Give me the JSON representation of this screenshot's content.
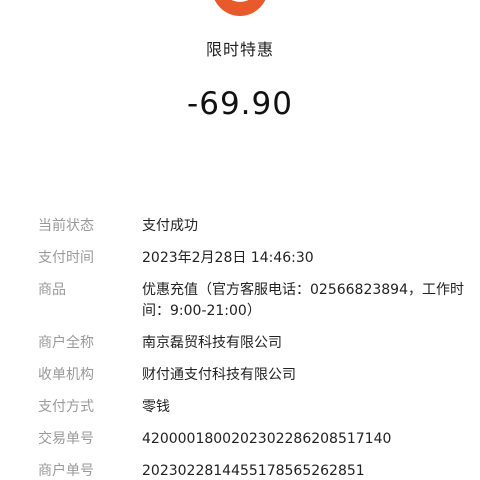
{
  "header": {
    "title": "限时特惠",
    "amount": "-69.90"
  },
  "details": [
    {
      "label": "当前状态",
      "value": "支付成功"
    },
    {
      "label": "支付时间",
      "value": "2023年2月28日 14:46:30"
    },
    {
      "label": "商品",
      "value": "优惠充值（官方客服电话：02566823894，工作时间：9:00-21:00）"
    },
    {
      "label": "商户全称",
      "value": "南京磊贸科技有限公司"
    },
    {
      "label": "收单机构",
      "value": "财付通支付科技有限公司"
    },
    {
      "label": "支付方式",
      "value": "零钱"
    },
    {
      "label": "交易单号",
      "value": "4200001800202302286208517140"
    },
    {
      "label": "商户单号",
      "value": "2023022814455178565262851"
    }
  ],
  "colors": {
    "logo": "#e85a2b",
    "label": "#9a9a9a",
    "value": "#222222"
  }
}
